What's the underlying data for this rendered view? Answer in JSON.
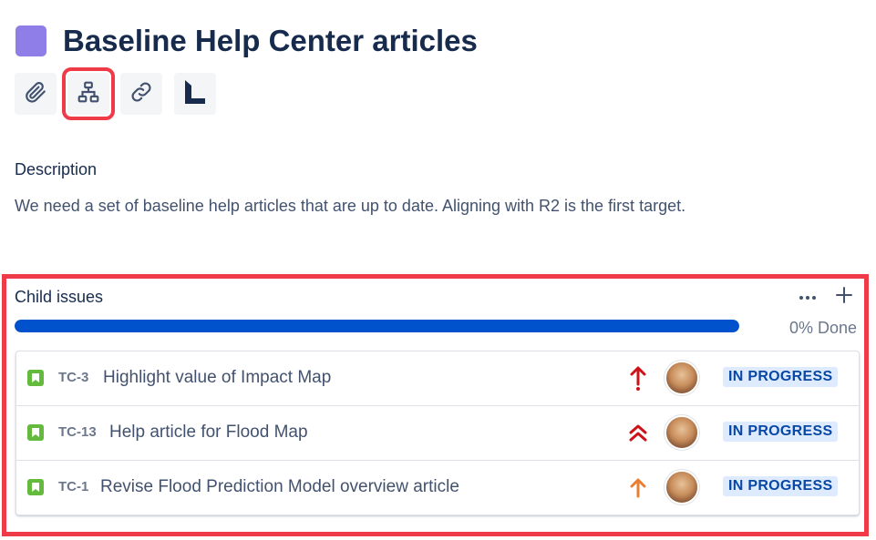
{
  "issue": {
    "epic_color": "#8f7ee7",
    "title": "Baseline Help Center articles"
  },
  "toolbar": {
    "buttons": [
      {
        "name": "attach",
        "icon": "paperclip-icon"
      },
      {
        "name": "child-issue",
        "icon": "hierarchy-icon",
        "highlighted": true
      },
      {
        "name": "link",
        "icon": "link-icon"
      },
      {
        "name": "app",
        "icon": "app-logo-icon"
      }
    ]
  },
  "description": {
    "heading": "Description",
    "text": "We need a set of baseline help articles that are up to date. Aligning with R2 is the first target."
  },
  "child_issues": {
    "heading": "Child issues",
    "more_icon": "more-icon",
    "add_icon": "plus-icon",
    "progress_percent": 0,
    "progress_label": "0% Done",
    "items": [
      {
        "key": "TC-3",
        "summary": "Highlight value of Impact Map",
        "priority": "high",
        "status": "IN PROGRESS"
      },
      {
        "key": "TC-13",
        "summary": "Help article for Flood Map",
        "priority": "highest",
        "status": "IN PROGRESS"
      },
      {
        "key": "TC-1",
        "summary": "Revise Flood Prediction Model overview article",
        "priority": "medium",
        "status": "IN PROGRESS"
      }
    ]
  },
  "colors": {
    "highlight_border": "#ef3b48",
    "progress_fill": "#0052cc",
    "story_icon": "#63ba3c",
    "priority_high": "#cd1317",
    "priority_medium": "#e97f33",
    "status_bg": "#deebff",
    "status_text": "#0747a6"
  }
}
